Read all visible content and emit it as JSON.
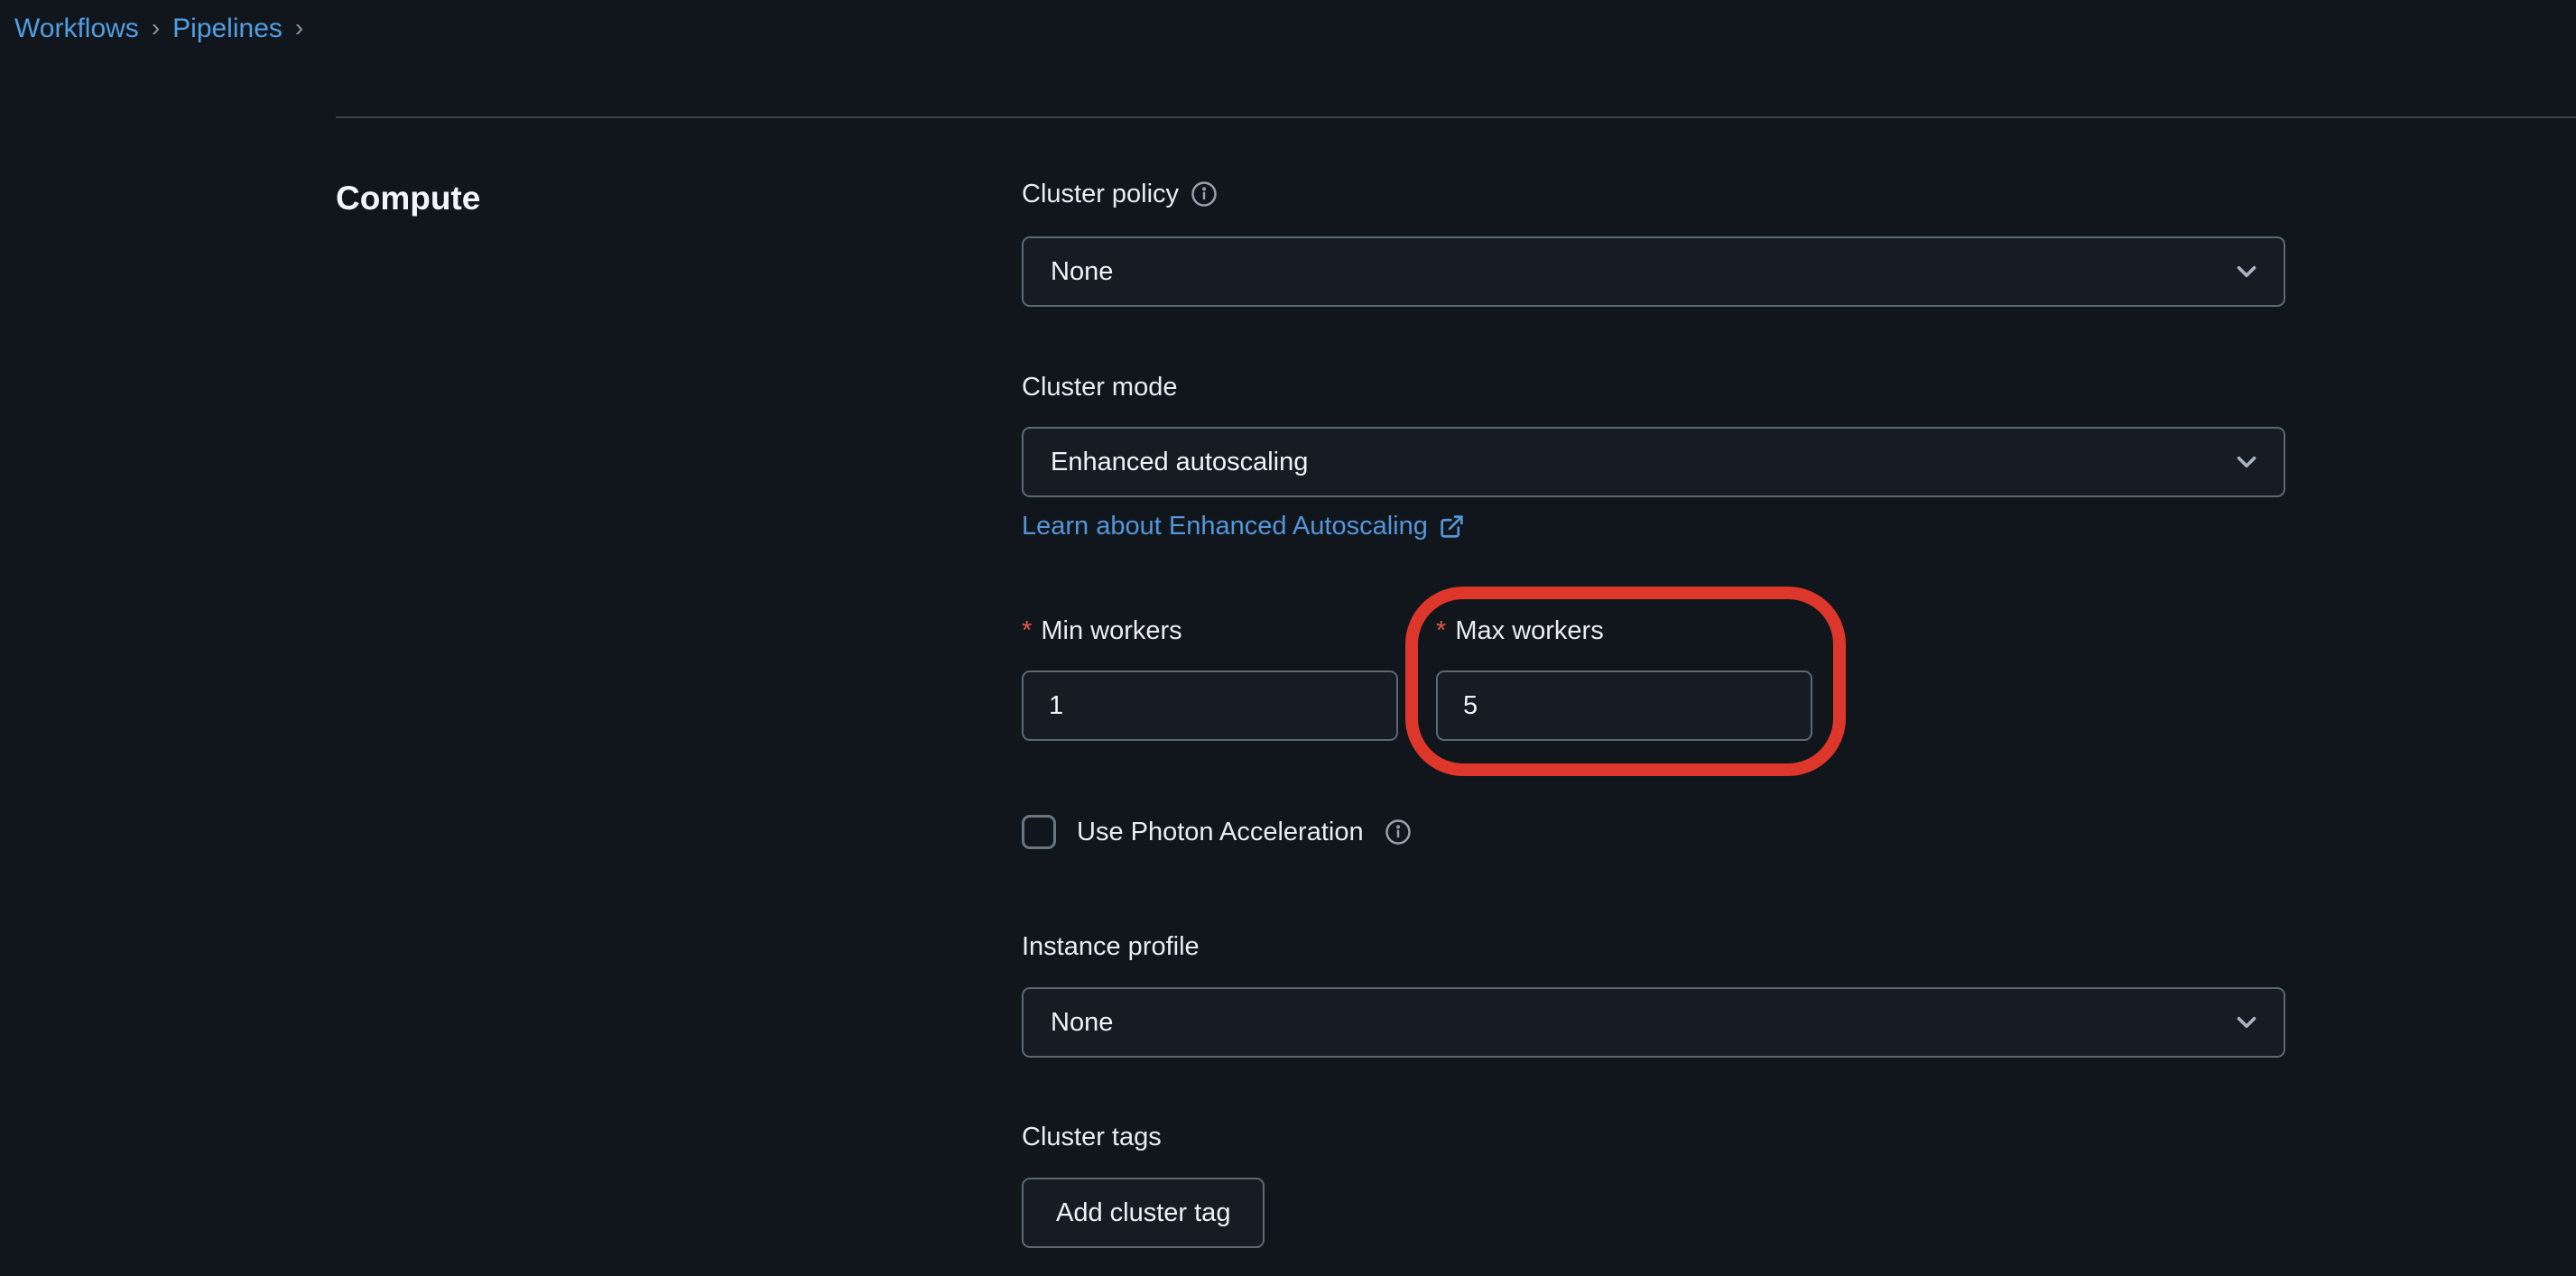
{
  "breadcrumb": {
    "separator": "›",
    "items": [
      {
        "label": "Workflows"
      },
      {
        "label": "Pipelines"
      }
    ]
  },
  "section": {
    "title": "Compute"
  },
  "form": {
    "cluster_policy": {
      "label": "Cluster policy",
      "value": "None"
    },
    "cluster_mode": {
      "label": "Cluster mode",
      "value": "Enhanced autoscaling"
    },
    "learn_link": {
      "label": "Learn about Enhanced Autoscaling"
    },
    "min_workers": {
      "label": "Min workers",
      "required_marker": "*",
      "value": "1"
    },
    "max_workers": {
      "label": "Max workers",
      "required_marker": "*",
      "value": "5"
    },
    "photon": {
      "label": "Use Photon Acceleration",
      "checked": false
    },
    "instance_profile": {
      "label": "Instance profile",
      "value": "None"
    },
    "cluster_tags": {
      "label": "Cluster tags",
      "button_label": "Add cluster tag"
    }
  },
  "colors": {
    "background": "#11161c",
    "link_blue": "#519ee3",
    "required_red": "#e4574b",
    "annotation_red": "#dc372a",
    "border_slate": "#5d6873"
  }
}
